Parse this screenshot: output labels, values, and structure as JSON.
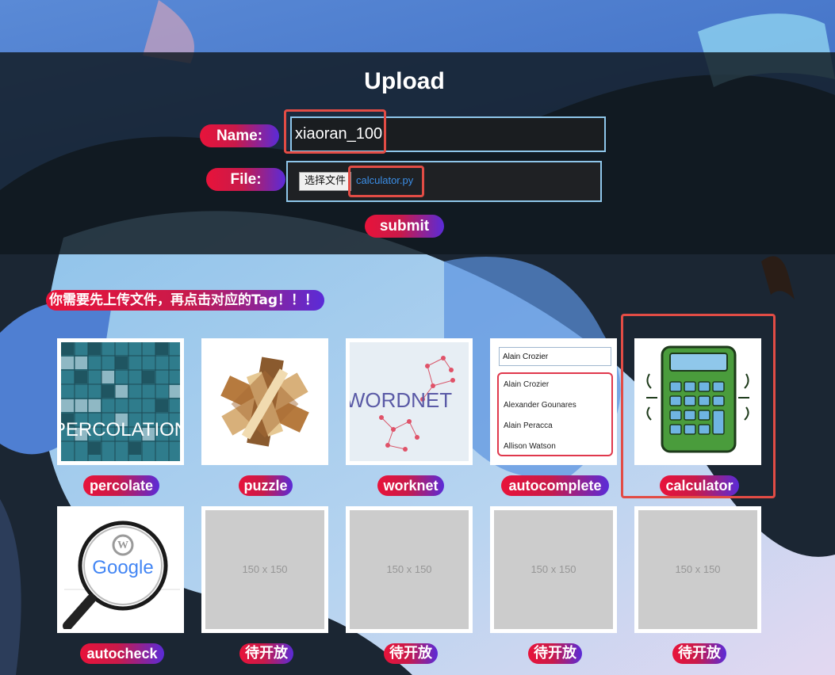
{
  "upload": {
    "title": "Upload",
    "name_label": "Name:",
    "name_value": "xiaoran_100",
    "file_label": "File:",
    "choose_button": "选择文件",
    "chosen_file": "calculator.py",
    "submit_label": "submit"
  },
  "notice": "你需要先上传文件，再点击对应的Tag！！！",
  "tags_row1": [
    {
      "label": "percolate",
      "thumb_text": "PERCOLATION"
    },
    {
      "label": "puzzle"
    },
    {
      "label": "worknet",
      "thumb_text": "WORDNET"
    },
    {
      "label": "autocomplete",
      "thumb_input": "Alain Crozier",
      "thumb_items": [
        "Alain Crozier",
        "Alexander Gounares",
        "Alain Peracca",
        "Allison Watson"
      ]
    },
    {
      "label": "calculator"
    }
  ],
  "tags_row2": [
    {
      "label": "autocheck",
      "thumb_text": "Google"
    },
    {
      "label": "待开放",
      "placeholder": "150 x 150"
    },
    {
      "label": "待开放",
      "placeholder": "150 x 150"
    },
    {
      "label": "待开放",
      "placeholder": "150 x 150"
    },
    {
      "label": "待开放",
      "placeholder": "150 x 150"
    }
  ],
  "colors": {
    "accent_red": "#e8133a",
    "accent_purple": "#5a2bd8",
    "input_border": "#8ec6ea",
    "highlight_box": "#e24c45"
  }
}
